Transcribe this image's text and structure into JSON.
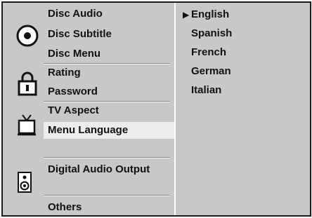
{
  "menu": {
    "disc": {
      "icon": "disc-icon",
      "items": [
        "Disc Audio",
        "Disc Subtitle",
        "Disc Menu"
      ]
    },
    "lock": {
      "icon": "padlock-icon",
      "items": [
        "Rating",
        "Password"
      ]
    },
    "tv": {
      "icon": "tv-icon",
      "items": [
        "TV Aspect",
        "Menu Language"
      ]
    },
    "speaker": {
      "icon": "speaker-icon",
      "items": [
        "Digital Audio Output"
      ]
    },
    "others": {
      "items": [
        "Others"
      ]
    },
    "selected_item": "Menu Language"
  },
  "languages": {
    "marker": "▶",
    "options": [
      "English",
      "Spanish",
      "French",
      "German",
      "Italian"
    ],
    "selected": "English"
  },
  "colors": {
    "panel": "#c8c8c8",
    "highlight": "#ececec",
    "frame": "#1a1a1a",
    "text": "#111111"
  }
}
